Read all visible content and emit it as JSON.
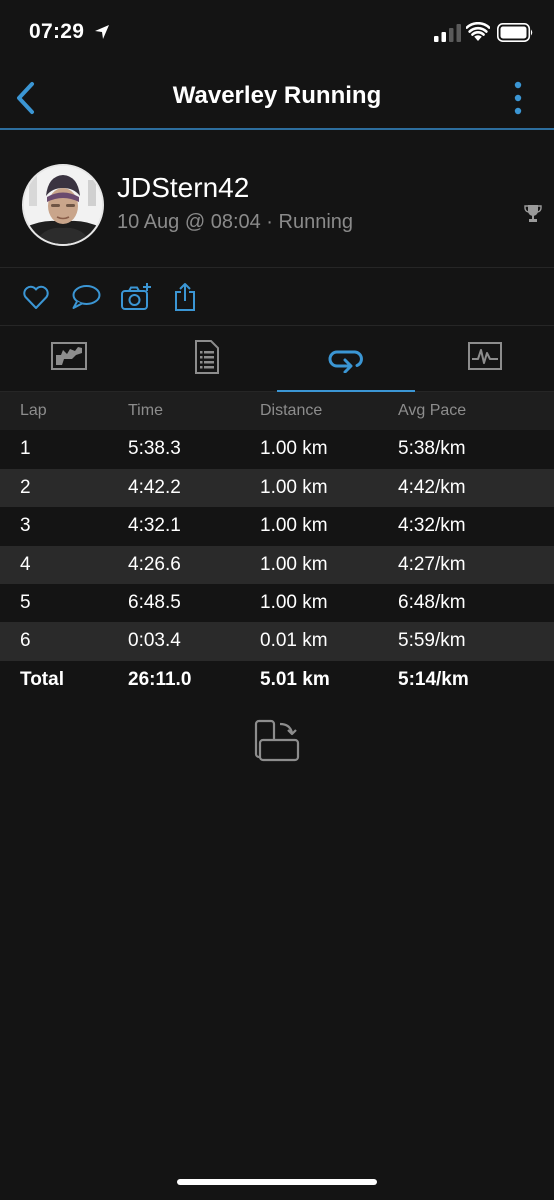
{
  "status_bar": {
    "time": "07:29"
  },
  "nav": {
    "title": "Waverley Running"
  },
  "profile": {
    "username": "JDStern42",
    "meta": "10 Aug @ 08:04 · Running"
  },
  "actions": [
    {
      "icon": "heart-icon"
    },
    {
      "icon": "comment-icon"
    },
    {
      "icon": "add-photo-icon"
    },
    {
      "icon": "share-icon"
    }
  ],
  "tabs": [
    {
      "icon": "map-chart-icon"
    },
    {
      "icon": "details-icon"
    },
    {
      "icon": "laps-icon",
      "active": true
    },
    {
      "icon": "graph-icon"
    }
  ],
  "laps": {
    "columns": [
      "Lap",
      "Time",
      "Distance",
      "Avg Pace"
    ],
    "rows": [
      {
        "lap": "1",
        "time": "5:38.3",
        "distance": "1.00 km",
        "pace": "5:38/km"
      },
      {
        "lap": "2",
        "time": "4:42.2",
        "distance": "1.00 km",
        "pace": "4:42/km"
      },
      {
        "lap": "3",
        "time": "4:32.1",
        "distance": "1.00 km",
        "pace": "4:32/km"
      },
      {
        "lap": "4",
        "time": "4:26.6",
        "distance": "1.00 km",
        "pace": "4:27/km"
      },
      {
        "lap": "5",
        "time": "6:48.5",
        "distance": "1.00 km",
        "pace": "6:48/km"
      },
      {
        "lap": "6",
        "time": "0:03.4",
        "distance": "0.01 km",
        "pace": "5:59/km"
      }
    ],
    "total": {
      "lap": "Total",
      "time": "26:11.0",
      "distance": "5.01 km",
      "pace": "5:14/km"
    }
  },
  "colors": {
    "accent": "#3b96d4",
    "background": "#141414",
    "row_alt": "#2a2a2a",
    "muted_text": "#8a8a8a"
  }
}
